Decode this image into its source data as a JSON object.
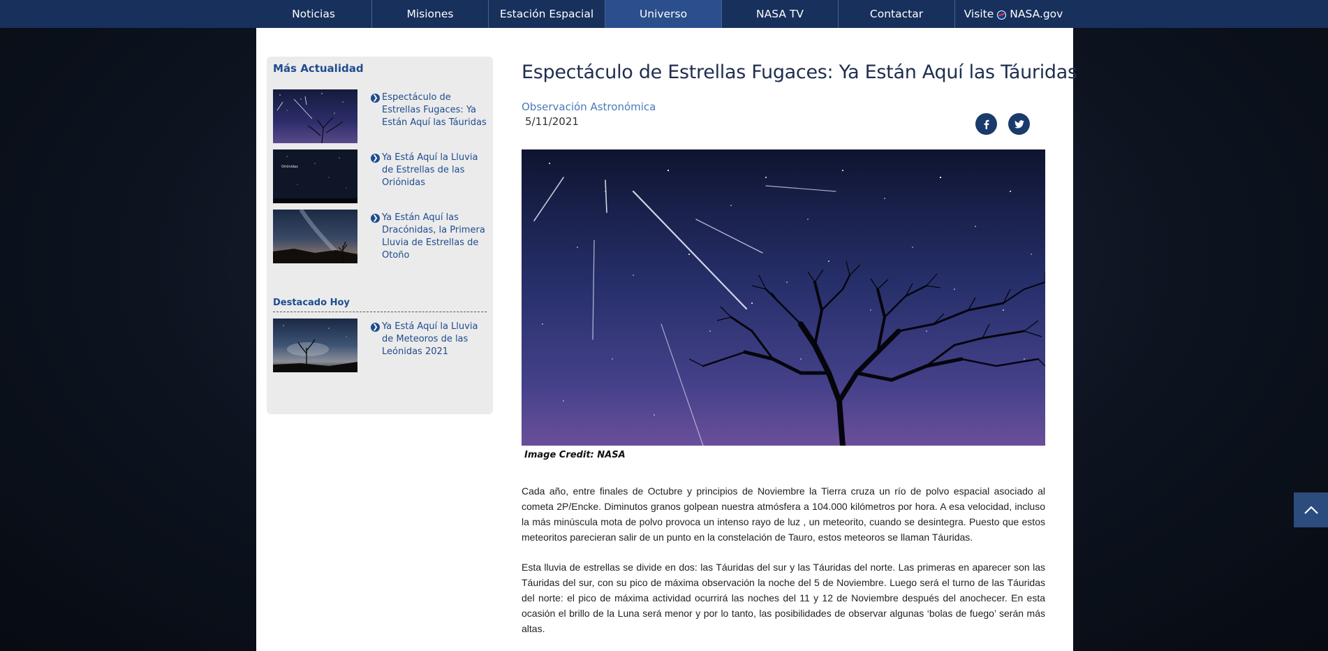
{
  "nav": {
    "items": [
      "Noticias",
      "Misiones",
      "Estación Espacial",
      "Universo",
      "NASA TV",
      "Contactar"
    ],
    "active": "Universo",
    "visit_prefix": "Visite",
    "visit_suffix": "NASA.gov"
  },
  "sidebar": {
    "heading": "Más Actualidad",
    "items": [
      {
        "label": "Espectáculo de Estrellas Fugaces: Ya Están Aquí las Táuridas"
      },
      {
        "label": "Ya Está Aquí la Lluvia de Estrellas de las Oriónidas",
        "thumb_text": "Oriónidas"
      },
      {
        "label": "Ya Están Aquí las Dracónidas, la Primera Lluvia de Estrellas de Otoño"
      }
    ],
    "featured_heading": "Destacado Hoy",
    "featured": [
      {
        "label": "Ya Está Aquí la Lluvia de Meteoros de las Leónidas 2021"
      }
    ]
  },
  "article": {
    "title": "Espectáculo de Estrellas Fugaces: Ya Están Aquí las Táuridas",
    "category": "Observación Astronómica",
    "date": "5/11/2021",
    "image_credit": "Image Credit: NASA",
    "paragraphs": [
      "Cada año, entre finales de Octubre y principios de Noviembre la Tierra cruza un río de polvo espacial asociado al cometa 2P/Encke. Diminutos granos golpean nuestra atmósfera a 104.000 kilómetros por hora. A esa velocidad, incluso la más minúscula mota de polvo provoca un intenso rayo de luz , un meteorito, cuando se desintegra. Puesto que estos meteoritos parecieran salir de un punto en la constelación de Tauro, estos meteoros se llaman Táuridas.",
      "Esta lluvia de estrellas se divide en dos: las Táuridas del sur y las Táuridas del norte. Las primeras en aparecer son las Táuridas del sur, con su pico de máxima observación la noche del 5 de Noviembre. Luego será el turno de las Táuridas del norte: el pico de máxima actividad ocurrirá las noches del 11 y 12 de Noviembre después del anochecer. En esta ocasión el brillo de la Luna será menor y por lo tanto, las posibilidades de observar algunas ‘bolas de fuego’ serán más altas."
    ]
  },
  "icons": {
    "share": [
      "facebook-icon",
      "twitter-icon"
    ],
    "bullet": "chevron-circle-right-icon",
    "back_to_top": "chevron-up-icon"
  },
  "colors": {
    "nav_bg": "#17305c",
    "nav_active": "#2b4f8c",
    "link_blue": "#1f4c8f",
    "category_blue": "#4b79b8",
    "title": "#1f2e4f"
  }
}
